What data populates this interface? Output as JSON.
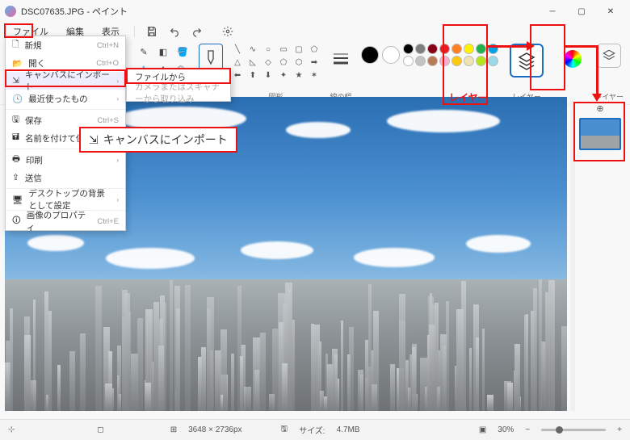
{
  "title": "DSC07635.JPG - ペイント",
  "menu": {
    "file": "ファイル",
    "edit": "編集",
    "view": "表示"
  },
  "file_menu": {
    "new": "新規",
    "new_sc": "Ctrl+N",
    "open": "開く",
    "open_sc": "Ctrl+O",
    "recent": "最近使ったもの",
    "import": "キャンバスにインポート",
    "save": "保存",
    "save_sc": "Ctrl+S",
    "save_as": "名前を付けて保存",
    "print": "印刷",
    "send": "送信",
    "set_bg": "デスクトップの背景として設定",
    "props": "画像のプロパティ",
    "props_sc": "Ctrl+E"
  },
  "import_sub": {
    "from_file": "ファイルから",
    "from_scanner": "カメラまたはスキャナーから取り込み"
  },
  "ribbon": {
    "shapes": "図形",
    "stroke": "線の幅",
    "layers": "レイヤー"
  },
  "annotations": {
    "layers_label": "レイヤー",
    "import_callout": "キャンバスにインポート"
  },
  "status": {
    "cursor": "",
    "sel": "",
    "dims_icon": "⊞",
    "dims": "3648 × 2736px",
    "size_icon": "🖫",
    "size_label": "サイズ:",
    "size": "4.7MB",
    "zoom": "30%"
  },
  "colors_row1": [
    "#000000",
    "#7f7f7f",
    "#880015",
    "#ed1c24",
    "#ff7f27",
    "#fff200",
    "#22b14c",
    "#00a2e8"
  ],
  "colors_row2": [
    "#ffffff",
    "#c3c3c3",
    "#b97a57",
    "#ffaec9",
    "#ffc90e",
    "#efe4b0",
    "#b5e61d",
    "#99d9ea"
  ]
}
